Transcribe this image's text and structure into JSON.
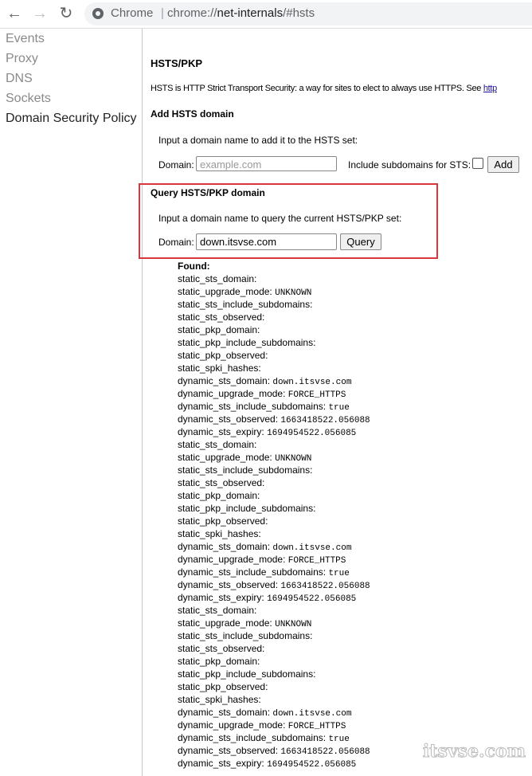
{
  "browser": {
    "site_name": "Chrome",
    "url_prefix": "chrome://",
    "url_host": "net-internals",
    "url_path": "/#hsts"
  },
  "sidebar": {
    "items": [
      {
        "label": "Events",
        "active": false
      },
      {
        "label": "Proxy",
        "active": false
      },
      {
        "label": "DNS",
        "active": false
      },
      {
        "label": "Sockets",
        "active": false
      },
      {
        "label": "Domain Security Policy",
        "active": true
      }
    ]
  },
  "main": {
    "title": "HSTS/PKP",
    "description": "HSTS is HTTP Strict Transport Security: a way for sites to elect to always use HTTPS. See ",
    "description_link": "http",
    "add": {
      "heading": "Add HSTS domain",
      "instruction": "Input a domain name to add it to the HSTS set:",
      "domain_label": "Domain:",
      "domain_placeholder": "example.com",
      "subdomains_label": "Include subdomains for STS:",
      "subdomains_checked": false,
      "button": "Add"
    },
    "query": {
      "heading": "Query HSTS/PKP domain",
      "instruction": "Input a domain name to query the current HSTS/PKP set:",
      "domain_label": "Domain:",
      "domain_value": "down.itsvse.com",
      "button": "Query",
      "highlight_color": "#d9363e"
    },
    "result": {
      "status": "Found:",
      "entries": [
        {
          "key": "static_sts_domain:",
          "value": ""
        },
        {
          "key": "static_upgrade_mode:",
          "value": "UNKNOWN"
        },
        {
          "key": "static_sts_include_subdomains:",
          "value": ""
        },
        {
          "key": "static_sts_observed:",
          "value": ""
        },
        {
          "key": "static_pkp_domain:",
          "value": ""
        },
        {
          "key": "static_pkp_include_subdomains:",
          "value": ""
        },
        {
          "key": "static_pkp_observed:",
          "value": ""
        },
        {
          "key": "static_spki_hashes:",
          "value": ""
        },
        {
          "key": "dynamic_sts_domain:",
          "value": "down.itsvse.com"
        },
        {
          "key": "dynamic_upgrade_mode:",
          "value": "FORCE_HTTPS"
        },
        {
          "key": "dynamic_sts_include_subdomains:",
          "value": "true"
        },
        {
          "key": "dynamic_sts_observed:",
          "value": "1663418522.056088"
        },
        {
          "key": "dynamic_sts_expiry:",
          "value": "1694954522.056085"
        },
        {
          "key": "static_sts_domain:",
          "value": ""
        },
        {
          "key": "static_upgrade_mode:",
          "value": "UNKNOWN"
        },
        {
          "key": "static_sts_include_subdomains:",
          "value": ""
        },
        {
          "key": "static_sts_observed:",
          "value": ""
        },
        {
          "key": "static_pkp_domain:",
          "value": ""
        },
        {
          "key": "static_pkp_include_subdomains:",
          "value": ""
        },
        {
          "key": "static_pkp_observed:",
          "value": ""
        },
        {
          "key": "static_spki_hashes:",
          "value": ""
        },
        {
          "key": "dynamic_sts_domain:",
          "value": "down.itsvse.com"
        },
        {
          "key": "dynamic_upgrade_mode:",
          "value": "FORCE_HTTPS"
        },
        {
          "key": "dynamic_sts_include_subdomains:",
          "value": "true"
        },
        {
          "key": "dynamic_sts_observed:",
          "value": "1663418522.056088"
        },
        {
          "key": "dynamic_sts_expiry:",
          "value": "1694954522.056085"
        },
        {
          "key": "static_sts_domain:",
          "value": ""
        },
        {
          "key": "static_upgrade_mode:",
          "value": "UNKNOWN"
        },
        {
          "key": "static_sts_include_subdomains:",
          "value": ""
        },
        {
          "key": "static_sts_observed:",
          "value": ""
        },
        {
          "key": "static_pkp_domain:",
          "value": ""
        },
        {
          "key": "static_pkp_include_subdomains:",
          "value": ""
        },
        {
          "key": "static_pkp_observed:",
          "value": ""
        },
        {
          "key": "static_spki_hashes:",
          "value": ""
        },
        {
          "key": "dynamic_sts_domain:",
          "value": "down.itsvse.com"
        },
        {
          "key": "dynamic_upgrade_mode:",
          "value": "FORCE_HTTPS"
        },
        {
          "key": "dynamic_sts_include_subdomains:",
          "value": "true"
        },
        {
          "key": "dynamic_sts_observed:",
          "value": "1663418522.056088"
        },
        {
          "key": "dynamic_sts_expiry:",
          "value": "1694954522.056085"
        }
      ]
    }
  },
  "watermark": "itsvse.com"
}
